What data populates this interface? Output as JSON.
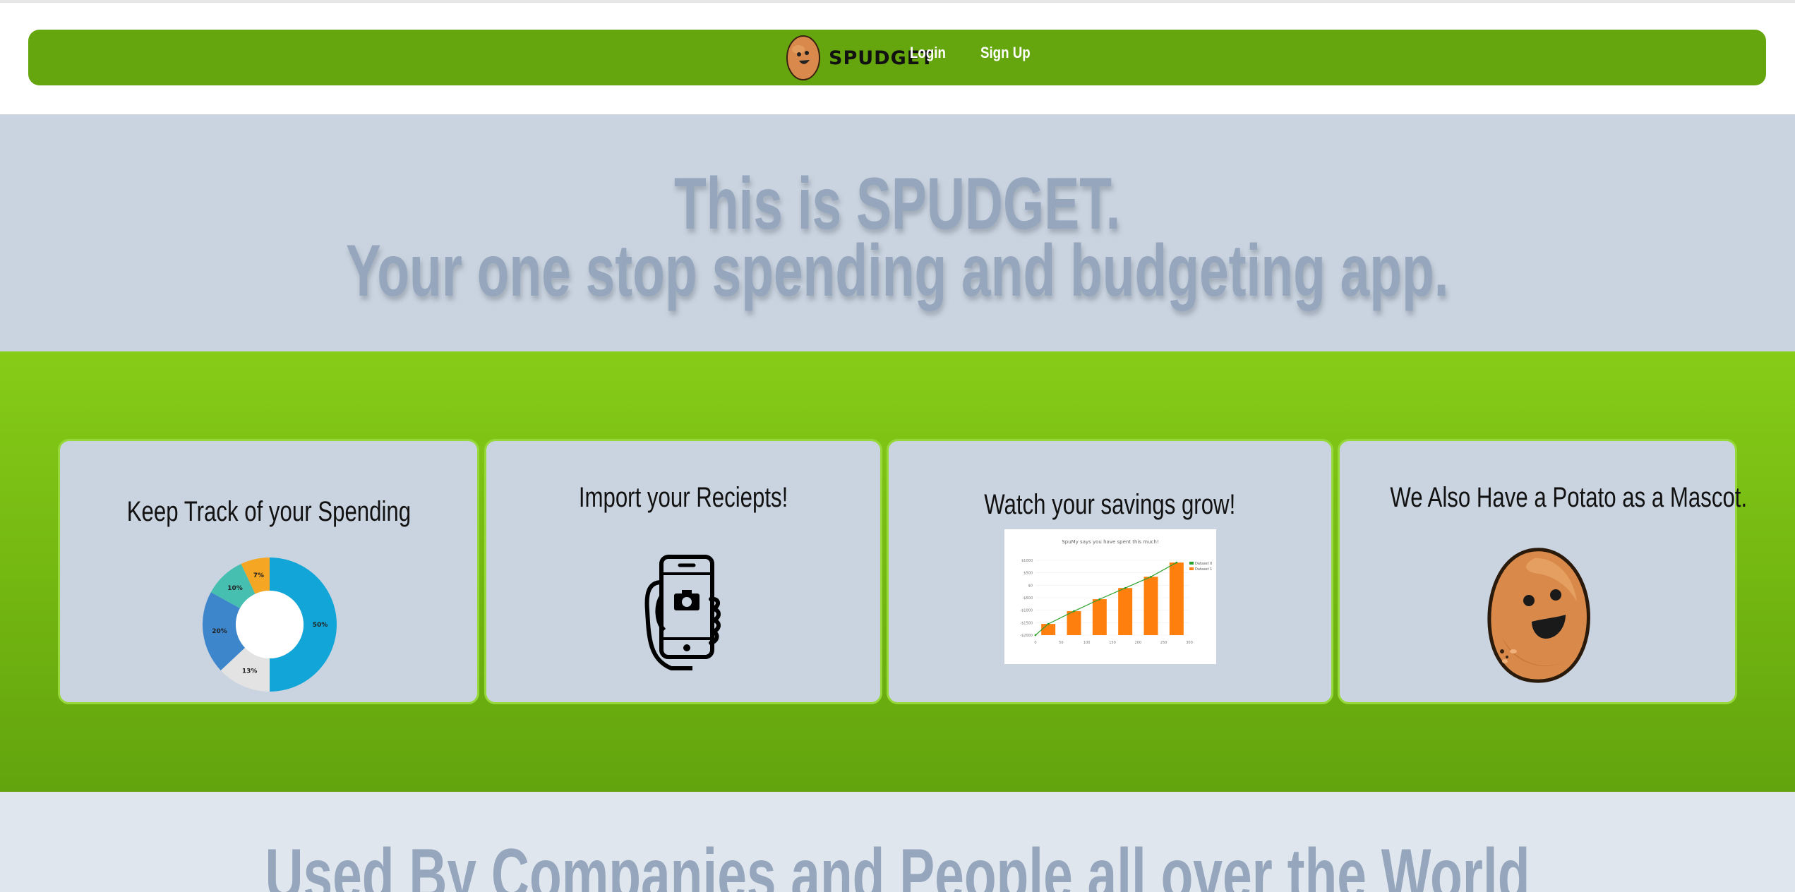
{
  "nav": {
    "brand": "SPUDGET",
    "login": "Login",
    "signup": "Sign Up"
  },
  "hero": {
    "line1": "This is SPUDGET.",
    "line2": "Your one stop spending and budgeting app."
  },
  "features": [
    {
      "title": "Keep Track of your Spending",
      "icon": "donut-chart-image"
    },
    {
      "title": "Import your Reciepts!",
      "icon": "phone-camera-icon"
    },
    {
      "title": "Watch your savings grow!",
      "icon": "savings-chart-image"
    },
    {
      "title": "We Also Have a Potato as a Mascot.",
      "icon": "potato-mascot-image"
    }
  ],
  "donut": {
    "segments": [
      {
        "label": "50%",
        "value": 50,
        "color": "#12a6d8"
      },
      {
        "label": "13%",
        "value": 13,
        "color": "#e3e3e3"
      },
      {
        "label": "20%",
        "value": 20,
        "color": "#3d86cc"
      },
      {
        "label": "10%",
        "value": 10,
        "color": "#46bfb0"
      },
      {
        "label": "7%",
        "value": 7,
        "color": "#f5a623"
      }
    ]
  },
  "savings_chart": {
    "title": "SpuMy says you have spent this much!",
    "legend": [
      "Dataset 0",
      "Dataset 1"
    ],
    "x_ticks": [
      "0",
      "50",
      "100",
      "150",
      "200",
      "250",
      "300"
    ],
    "y_ticks": [
      "$1000",
      "$500",
      "$0",
      "-$500",
      "-$1000",
      "-$1500",
      "-$2000"
    ]
  },
  "lower": {
    "title": "Used By Companies and People all over the World"
  },
  "colors": {
    "nav_green": "#65a60e",
    "hero_bg": "#cad4e0",
    "hero_text": "#95a6bd",
    "band_top": "#86cc17",
    "band_bottom": "#62a40d",
    "bar_orange": "#ff7f0e",
    "line_green": "#2ca02c"
  }
}
